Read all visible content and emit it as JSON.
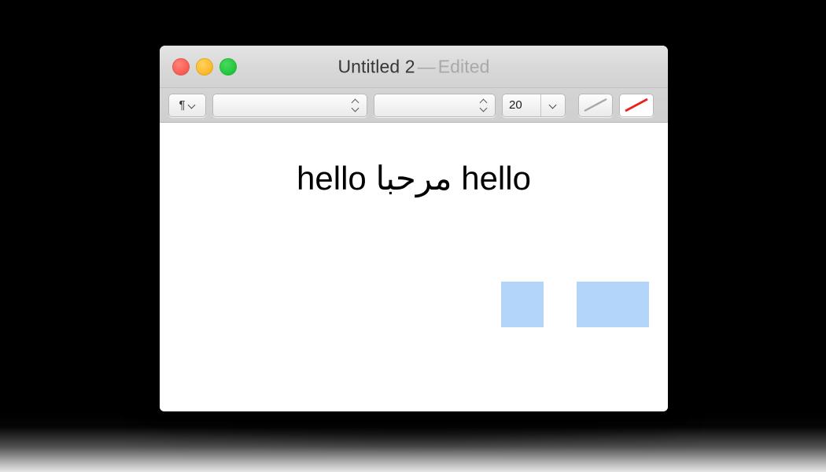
{
  "desktop": {
    "background_color": "#000000"
  },
  "window": {
    "titlebar": {
      "document_name": "Untitled 2",
      "separator": "—",
      "edited_state": "Edited",
      "traffic_lights": [
        {
          "name": "close",
          "color": "#fc6058"
        },
        {
          "name": "minimize",
          "color": "#fdbc2f"
        },
        {
          "name": "zoom",
          "color": "#28c940"
        }
      ]
    },
    "toolbar": {
      "paragraph_style": {
        "glyph": "¶",
        "chevron": "chevron-down-icon"
      },
      "font_family": {
        "value": "",
        "placeholder": ""
      },
      "font_typeface": {
        "value": "",
        "placeholder": ""
      },
      "font_size": {
        "value": "20",
        "placeholder": ""
      },
      "stroke_none": {
        "label": "",
        "line_color": "#a8a8a8"
      },
      "stroke_color": {
        "label": "",
        "line_color": "#e8201f"
      }
    },
    "document": {
      "text": "hello مرحبا hello",
      "font_size_px": 42,
      "text_color": "#000000",
      "selection_color": "#b4d5fa",
      "selection_runs": [
        {
          "name": "run-left",
          "text": "ello "
        },
        {
          "name": "run-right",
          "text": "حبا hell"
        }
      ]
    }
  }
}
